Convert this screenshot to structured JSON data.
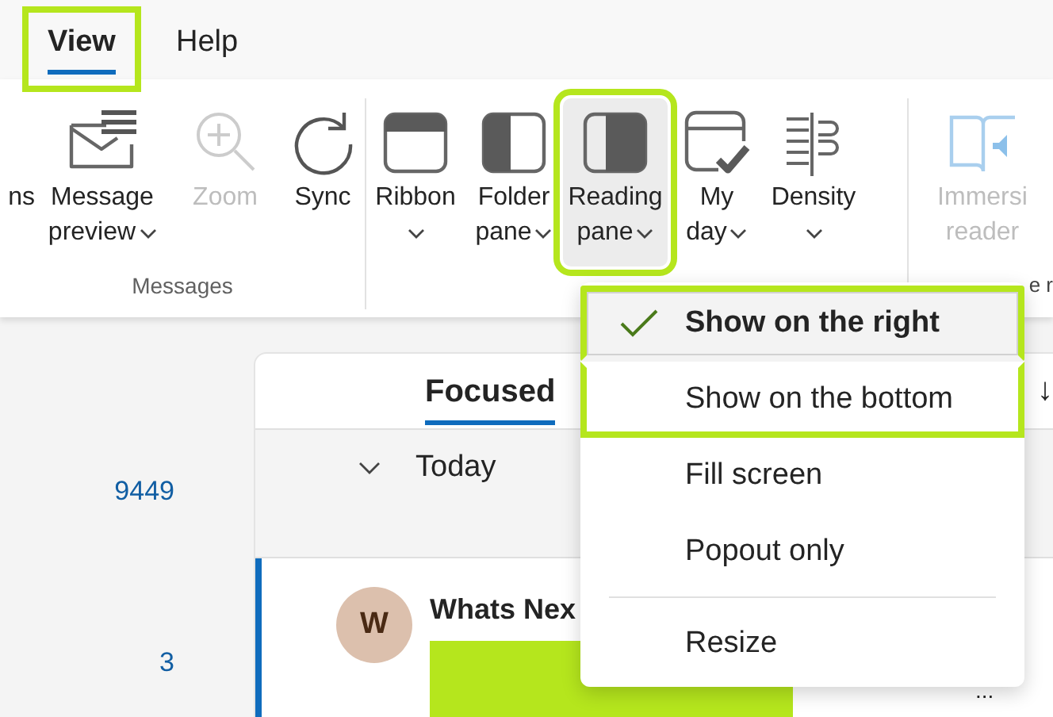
{
  "menu_tabs": [
    {
      "label": "View",
      "selected": true,
      "highlighted": true
    },
    {
      "label": "Help",
      "selected": false,
      "highlighted": false
    }
  ],
  "ribbon": {
    "groups": [
      {
        "label": "Messages",
        "items": [
          {
            "line1": "ns",
            "dropdown": false,
            "disabled": false,
            "selected": false,
            "highlighted": false
          },
          {
            "line1": "Message",
            "line2": "preview",
            "dropdown": true,
            "disabled": false,
            "selected": false,
            "highlighted": false
          },
          {
            "line1": "Zoom",
            "dropdown": false,
            "disabled": true,
            "selected": false,
            "highlighted": false
          },
          {
            "line1": "Sync",
            "dropdown": false,
            "disabled": false,
            "selected": false,
            "highlighted": false
          }
        ]
      },
      {
        "items": [
          {
            "line1": "Ribbon",
            "dropdown": true,
            "disabled": false,
            "selected": false,
            "highlighted": false
          },
          {
            "line1": "Folder",
            "line2": "pane",
            "dropdown": true,
            "disabled": false,
            "selected": false,
            "highlighted": false
          },
          {
            "line1": "Reading",
            "line2": "pane",
            "dropdown": true,
            "disabled": false,
            "selected": true,
            "highlighted": true
          },
          {
            "line1": "My",
            "line2": "day",
            "dropdown": true,
            "disabled": false,
            "selected": false,
            "highlighted": false
          },
          {
            "line1": "Density",
            "dropdown": true,
            "disabled": false,
            "selected": false,
            "highlighted": false
          }
        ]
      },
      {
        "label": "e r",
        "items": [
          {
            "line1": "Immersi",
            "line2": "reader",
            "dropdown": false,
            "disabled": true,
            "selected": false,
            "highlighted": false
          }
        ]
      }
    ]
  },
  "folder_pane": {
    "items": [
      {
        "count": "9449"
      },
      {
        "count": "3"
      }
    ]
  },
  "mail_list": {
    "tabs": [
      {
        "label": "Focused",
        "selected": true
      }
    ],
    "sort_glyph": "↓",
    "groups": [
      {
        "label": "Today",
        "expanded": true
      }
    ],
    "messages": [
      {
        "avatar": "W",
        "sender": "Whats Nex",
        "selected": true,
        "preview_redacted": true,
        "more": "..."
      }
    ]
  },
  "dropdown_menu": {
    "items": [
      {
        "kind": "option",
        "label": "Show on the right",
        "checked": true,
        "hovered": true,
        "highlighted": true
      },
      {
        "kind": "option",
        "label": "Show on the bottom",
        "checked": false,
        "hovered": false,
        "highlighted": true
      },
      {
        "kind": "option",
        "label": "Fill screen",
        "checked": false,
        "hovered": false,
        "highlighted": false
      },
      {
        "kind": "option",
        "label": "Popout only",
        "checked": false,
        "hovered": false,
        "highlighted": false
      },
      {
        "kind": "divider"
      },
      {
        "kind": "option",
        "label": "Resize",
        "checked": false,
        "hovered": false,
        "highlighted": false
      }
    ]
  }
}
